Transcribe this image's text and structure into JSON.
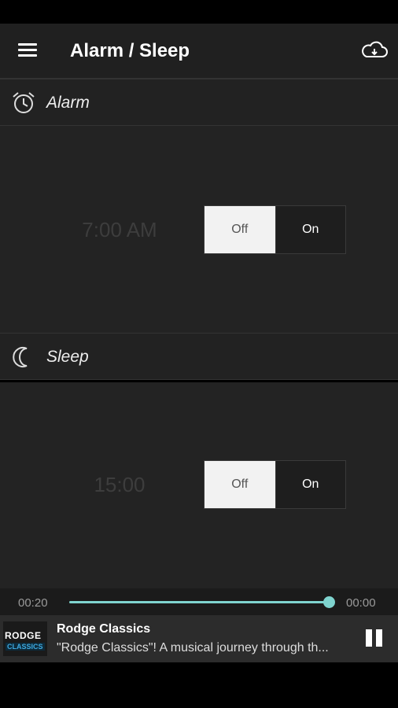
{
  "app": {
    "title": "Alarm / Sleep",
    "menu_icon": "hamburger-menu-icon",
    "cloud_icon": "cloud-icon"
  },
  "alarm": {
    "header_label": "Alarm",
    "icon": "alarm-clock-icon",
    "time": "7:00 AM",
    "toggle": {
      "off_label": "Off",
      "on_label": "On",
      "selected": "Off"
    }
  },
  "sleep": {
    "header_label": "Sleep",
    "icon": "moon-icon",
    "time": "15:00",
    "toggle": {
      "off_label": "Off",
      "on_label": "On",
      "selected": "Off"
    }
  },
  "player": {
    "elapsed": "00:20",
    "remaining": "00:00",
    "progress_fraction": 1.0,
    "logo_text_top": "RODGE",
    "logo_text_bottom": "CLASSICS",
    "station_name": "Rodge Classics",
    "description": "\"Rodge Classics\"! A musical journey through th...",
    "pause_icon": "pause-icon"
  },
  "colors": {
    "accent": "#7fd4cf",
    "background": "#232323",
    "header": "#202020"
  }
}
